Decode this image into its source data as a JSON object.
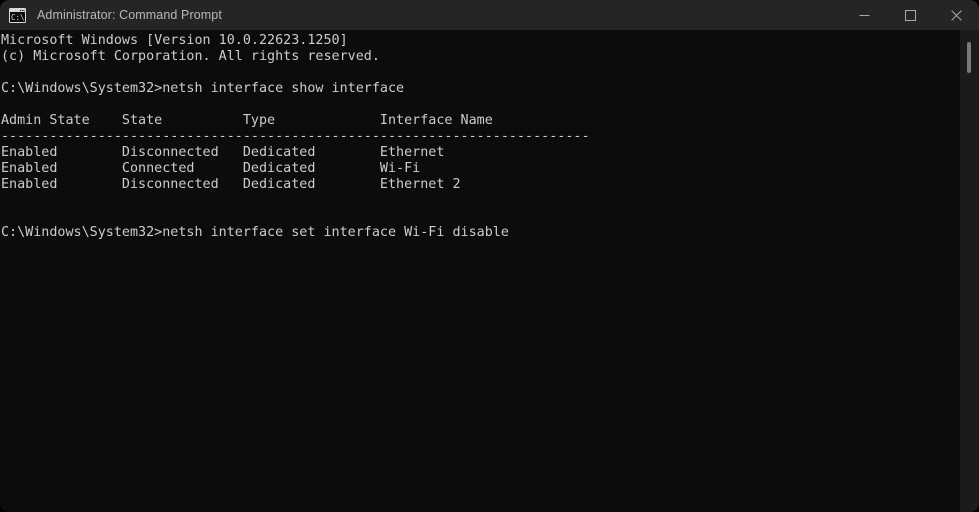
{
  "window": {
    "title": "Administrator: Command Prompt",
    "icon": "command-prompt-icon",
    "colors": {
      "titlebar_bg": "#252525",
      "terminal_bg": "#0c0c0c",
      "text": "#cccccc",
      "title_text": "#b9b9b9",
      "scrollbar_track": "#1b1b1b",
      "scrollbar_thumb": "#7a7a7a"
    },
    "controls": {
      "minimize": "minimize-icon",
      "maximize": "maximize-icon",
      "close": "close-icon"
    }
  },
  "terminal": {
    "prompt_path": "C:\\Windows\\System32>",
    "lines": [
      "Microsoft Windows [Version 10.0.22623.1250]",
      "(c) Microsoft Corporation. All rights reserved.",
      "",
      "C:\\Windows\\System32>netsh interface show interface",
      "",
      "Admin State    State          Type             Interface Name",
      "-------------------------------------------------------------------------",
      "Enabled        Disconnected   Dedicated        Ethernet",
      "Enabled        Connected      Dedicated        Wi-Fi",
      "Enabled        Disconnected   Dedicated        Ethernet 2",
      "",
      "",
      "C:\\Windows\\System32>netsh interface set interface Wi-Fi disable"
    ],
    "table": {
      "headers": [
        "Admin State",
        "State",
        "Type",
        "Interface Name"
      ],
      "rows": [
        [
          "Enabled",
          "Disconnected",
          "Dedicated",
          "Ethernet"
        ],
        [
          "Enabled",
          "Connected",
          "Dedicated",
          "Wi-Fi"
        ],
        [
          "Enabled",
          "Disconnected",
          "Dedicated",
          "Ethernet 2"
        ]
      ]
    },
    "commands": [
      "netsh interface show interface",
      "netsh interface set interface Wi-Fi disable"
    ],
    "version_banner": "Microsoft Windows [Version 10.0.22623.1250]",
    "copyright": "(c) Microsoft Corporation. All rights reserved."
  },
  "scrollbar": {
    "thumb_position": "top"
  }
}
